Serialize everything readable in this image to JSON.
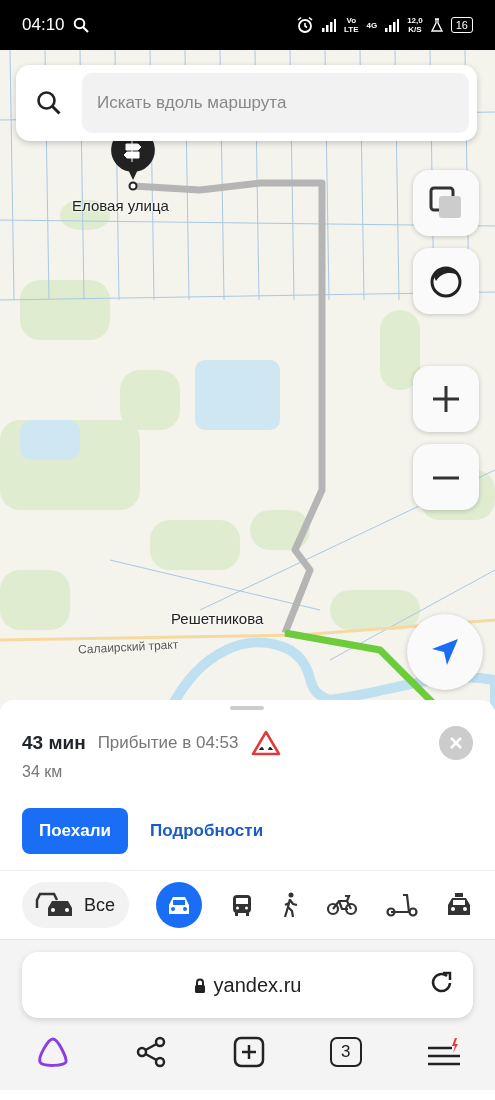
{
  "status_bar": {
    "time": "04:10",
    "volte_top": "Vo",
    "volte_bottom": "LTE",
    "network": "4G",
    "speed_value": "12,0",
    "speed_unit": "K/S",
    "battery": "16"
  },
  "map": {
    "search": {
      "placeholder": "Искать вдоль маршрута"
    },
    "labels": [
      {
        "text": "Еловая улица",
        "kind": "destination"
      },
      {
        "text": "Решетникова",
        "kind": "place"
      },
      {
        "text": "Салаирский тракт",
        "kind": "road"
      }
    ]
  },
  "route": {
    "duration": "43 мин",
    "arrival": "Прибытие в 04:53",
    "distance": "34 км",
    "go_button": "Поехали",
    "details_link": "Подробности"
  },
  "transport_modes": [
    {
      "kind": "all",
      "label": "Все",
      "selected": false
    },
    {
      "kind": "car",
      "selected": true
    },
    {
      "kind": "bus",
      "selected": false
    },
    {
      "kind": "walk",
      "selected": false
    },
    {
      "kind": "bike",
      "selected": false
    },
    {
      "kind": "scooter",
      "selected": false
    },
    {
      "kind": "taxi",
      "selected": false
    }
  ],
  "browser": {
    "url": "yandex.ru",
    "tabs_count": "3"
  }
}
